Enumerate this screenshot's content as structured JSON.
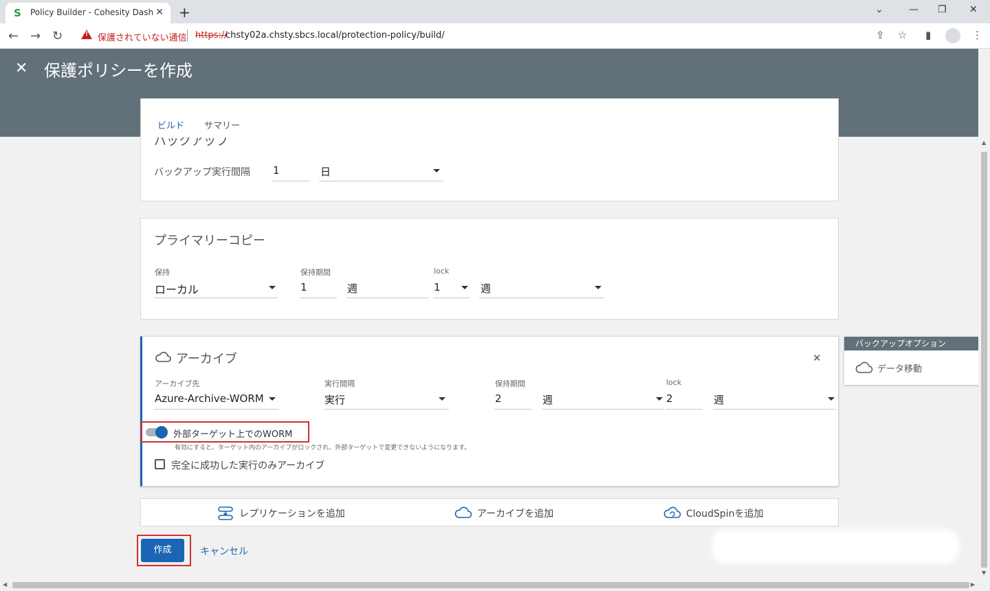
{
  "browser": {
    "tab_title": "Policy Builder - Cohesity Dashboard",
    "tab_close": "✕",
    "new_tab": "+",
    "security_warning": "保護されていない通信",
    "url_scheme": "https://",
    "url_rest": "chsty02a.chsty.sbcs.local/protection-policy/build/"
  },
  "header": {
    "close": "✕",
    "title": "保護ポリシーを作成"
  },
  "tabs": [
    {
      "label": "ビルド",
      "active": true
    },
    {
      "label": "サマリー",
      "active": false
    }
  ],
  "backup": {
    "title": "バックアップ",
    "interval_label": "バックアップ実行間隔",
    "interval_value": "1",
    "interval_unit": "日"
  },
  "primary_copy": {
    "title": "プライマリーコピー",
    "retention_label": "保持",
    "retention_value": "ローカル",
    "period_label": "保持期間",
    "period_value": "1",
    "period_unit": "週",
    "lock_label": "lock",
    "lock_value": "1",
    "lock_unit": "週"
  },
  "archive": {
    "title": "アーカイブ",
    "close": "✕",
    "target_label": "アーカイブ先",
    "target_value": "Azure-Archive-WORM",
    "interval_label": "実行間隔",
    "interval_value": "実行",
    "period_label": "保持期間",
    "period_value": "2",
    "period_unit": "週",
    "lock_label": "lock",
    "lock_value": "2",
    "lock_unit": "週",
    "worm_toggle_label": "外部ターゲット上でのWORM",
    "worm_toggle_on": true,
    "worm_help": "有効にすると、ターゲット内のアーカイブがロックされ、外部ターゲットで変更できないようになります。",
    "success_only_label": "完全に成功した実行のみアーカイブ",
    "success_only_checked": false
  },
  "add_actions": {
    "replication": "レプリケーションを追加",
    "archive": "アーカイブを追加",
    "cloudspin": "CloudSpinを追加"
  },
  "footer": {
    "create": "作成",
    "cancel": "キャンセル"
  },
  "side_panel": {
    "heading": "バックアップオプション",
    "item": "データ移動"
  },
  "colors": {
    "accent": "#1c64b4",
    "header_bg": "#617079",
    "highlight": "#d32f2f",
    "warning": "#c5221f"
  }
}
